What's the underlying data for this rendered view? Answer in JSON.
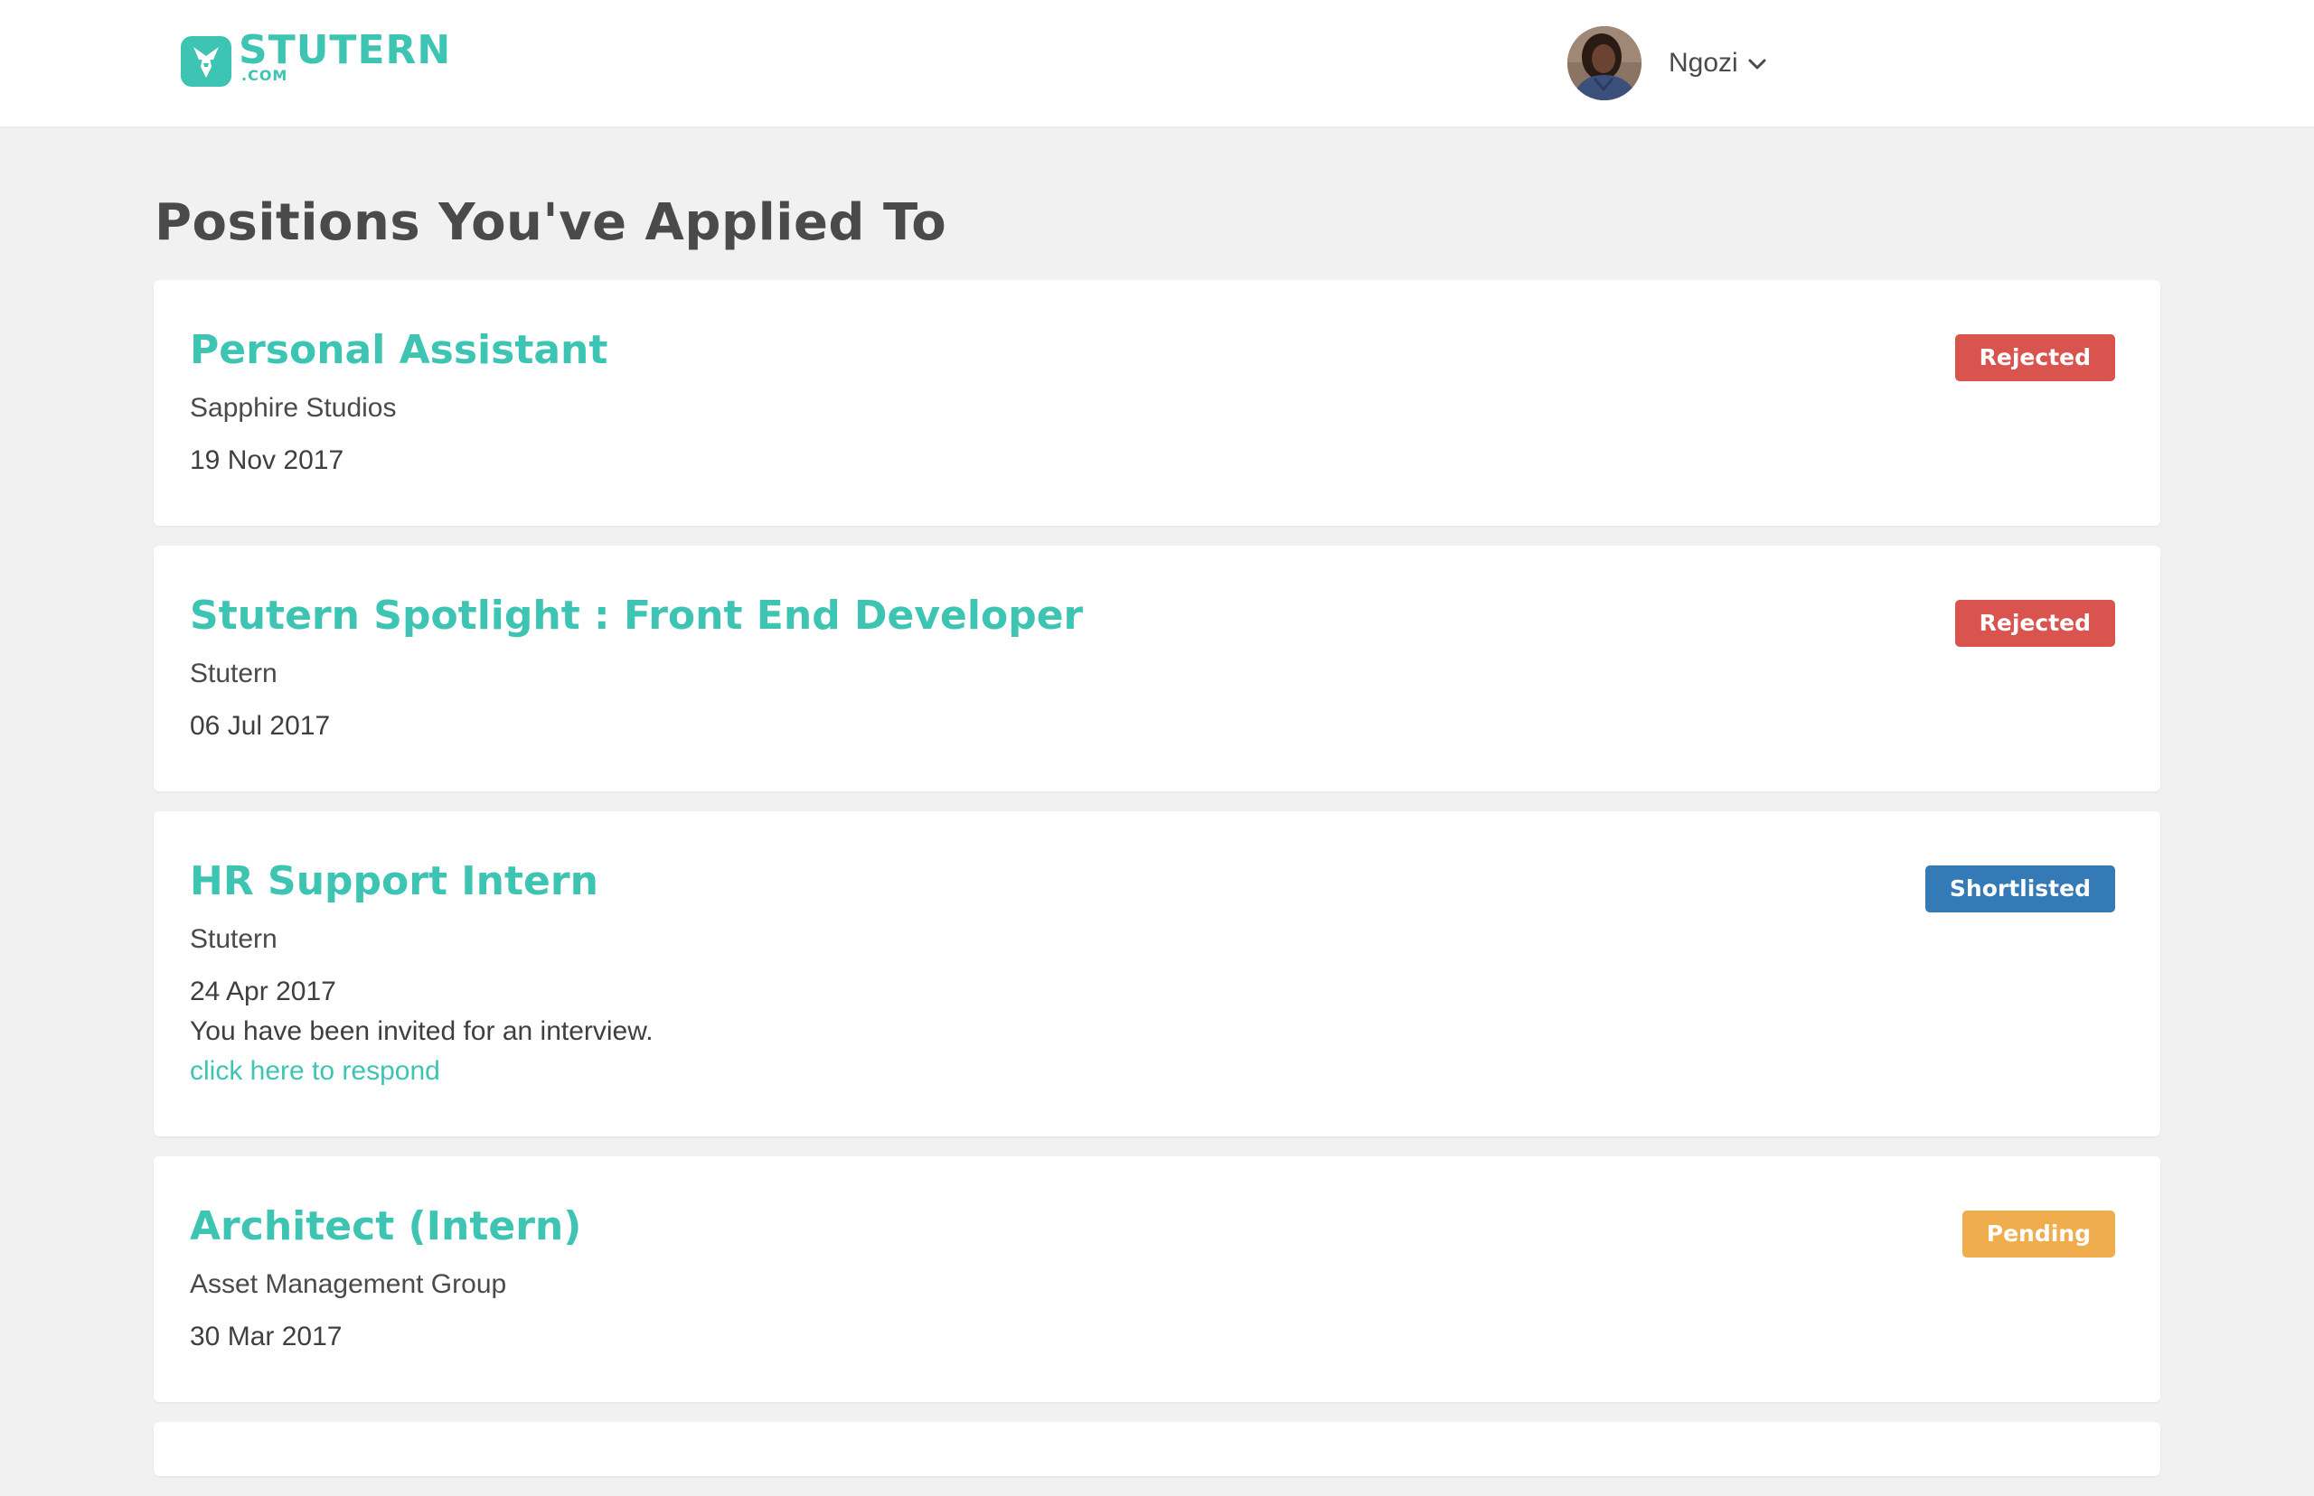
{
  "brand": {
    "name": "STUTERN",
    "suffix": ".COM",
    "color": "#3ec4b3"
  },
  "user": {
    "name": "Ngozi",
    "menu_icon": "chevron-down-icon"
  },
  "page": {
    "title": "Positions You've Applied To"
  },
  "applications": [
    {
      "title": "Personal Assistant",
      "company": "Sapphire Studios",
      "date": "19 Nov 2017",
      "status": "Rejected",
      "status_color": "#d9534f"
    },
    {
      "title": "Stutern Spotlight : Front End Developer",
      "company": "Stutern",
      "date": "06 Jul 2017",
      "status": "Rejected",
      "status_color": "#d9534f"
    },
    {
      "title": "HR Support Intern",
      "company": "Stutern",
      "date": "24 Apr 2017",
      "status": "Shortlisted",
      "status_color": "#337ab7",
      "note": "You have been invited for an interview.",
      "link": "click here to respond"
    },
    {
      "title": "Architect (Intern)",
      "company": "Asset Management Group",
      "date": "30 Mar 2017",
      "status": "Pending",
      "status_color": "#f0ad4e"
    }
  ]
}
